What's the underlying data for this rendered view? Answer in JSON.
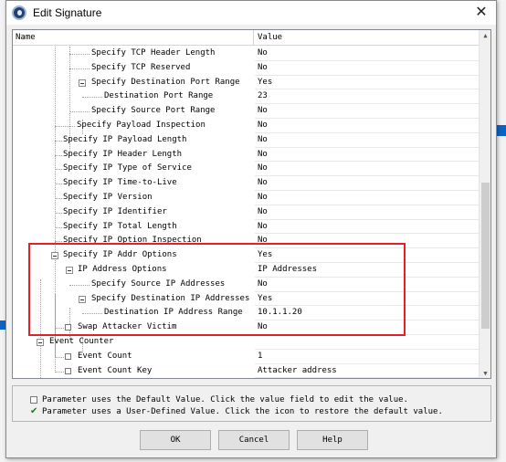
{
  "window": {
    "title": "Edit Signature",
    "close_glyph": "✕"
  },
  "grid": {
    "header": {
      "name": "Name",
      "value": "Value"
    },
    "rows": [
      {
        "label": "Specify TCP Header Length",
        "value": "No"
      },
      {
        "label": "Specify TCP Reserved",
        "value": "No"
      },
      {
        "label": "Specify Destination Port Range",
        "value": "Yes"
      },
      {
        "label": "Destination Port Range",
        "value": "23"
      },
      {
        "label": "Specify Source Port Range",
        "value": "No"
      },
      {
        "label": "Specify Payload Inspection",
        "value": "No"
      },
      {
        "label": "Specify IP Payload Length",
        "value": "No"
      },
      {
        "label": "Specify IP Header Length",
        "value": "No"
      },
      {
        "label": "Specify IP Type of Service",
        "value": "No"
      },
      {
        "label": "Specify IP Time-to-Live",
        "value": "No"
      },
      {
        "label": "Specify IP Version",
        "value": "No"
      },
      {
        "label": "Specify IP Identifier",
        "value": "No"
      },
      {
        "label": "Specify IP Total Length",
        "value": "No"
      },
      {
        "label": "Specify IP Option Inspection",
        "value": "No"
      },
      {
        "label": "Specify IP Addr Options",
        "value": "Yes"
      },
      {
        "label": "IP Address Options",
        "value": "IP Addresses"
      },
      {
        "label": "Specify Source IP Addresses",
        "value": "No"
      },
      {
        "label": "Specify Destination IP Addresses",
        "value": "Yes"
      },
      {
        "label": "Destination IP Address Range",
        "value": "10.1.1.20"
      },
      {
        "label": "Swap Attacker Victim",
        "value": "No"
      },
      {
        "label": "Event Counter",
        "value": ""
      },
      {
        "label": "Event Count",
        "value": "1"
      },
      {
        "label": "Event Count Key",
        "value": "Attacker address"
      }
    ]
  },
  "legend": {
    "default_text": "Parameter uses the Default Value.  Click the value field to edit the value.",
    "user_text": "Parameter uses a User-Defined Value.  Click the icon to restore the default value."
  },
  "buttons": {
    "ok": "OK",
    "cancel": "Cancel",
    "help": "Help"
  },
  "icons": {
    "app": "signature-app-icon",
    "expander": "tree-collapse-icon",
    "default": "default-value-checkbox-icon",
    "user": "user-defined-check-icon"
  },
  "colors": {
    "highlight": "#e0202a",
    "selection": "#0a64c8"
  }
}
